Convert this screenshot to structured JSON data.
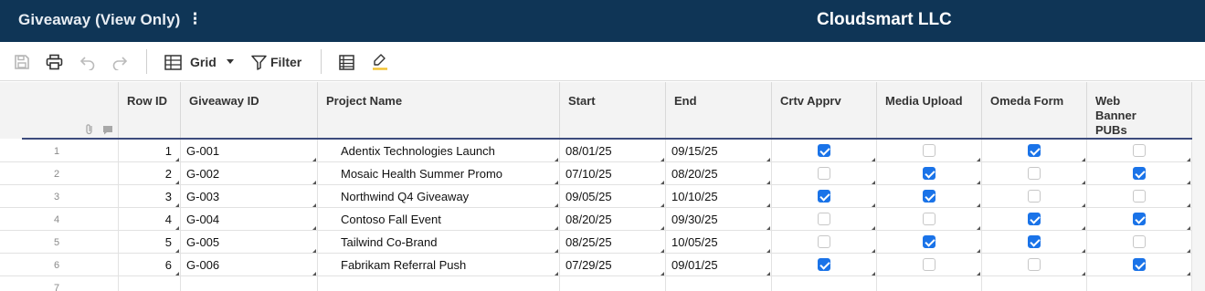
{
  "header": {
    "sheet_title": "Giveaway (View Only)",
    "title_menu_icon": "⋮",
    "company": "Cloudsmart LLC"
  },
  "toolbar": {
    "grid_label": "Grid",
    "filter_label": "Filter"
  },
  "columns": [
    {
      "key": "row_id",
      "label": "Row ID"
    },
    {
      "key": "giveaway_id",
      "label": "Giveaway ID"
    },
    {
      "key": "project_name",
      "label": "Project Name"
    },
    {
      "key": "start",
      "label": "Start"
    },
    {
      "key": "end",
      "label": "End"
    },
    {
      "key": "crtv_apprv",
      "label": "Crtv Apprv"
    },
    {
      "key": "media_upload",
      "label": "Media Upload"
    },
    {
      "key": "omeda_form",
      "label": "Omeda Form"
    },
    {
      "key": "web_banner_pubs",
      "label": "Web Banner PUBs"
    }
  ],
  "rows": [
    {
      "num": "1",
      "row_id": "1",
      "giveaway_id": "G-001",
      "project_name": "Adentix Technologies Launch",
      "start": "08/01/25",
      "end": "09/15/25",
      "crtv_apprv": true,
      "media_upload": false,
      "omeda_form": true,
      "web_banner_pubs": false
    },
    {
      "num": "2",
      "row_id": "2",
      "giveaway_id": "G-002",
      "project_name": "Mosaic Health Summer Promo",
      "start": "07/10/25",
      "end": "08/20/25",
      "crtv_apprv": false,
      "media_upload": true,
      "omeda_form": false,
      "web_banner_pubs": true
    },
    {
      "num": "3",
      "row_id": "3",
      "giveaway_id": "G-003",
      "project_name": "Northwind Q4 Giveaway",
      "start": "09/05/25",
      "end": "10/10/25",
      "crtv_apprv": true,
      "media_upload": true,
      "omeda_form": false,
      "web_banner_pubs": false
    },
    {
      "num": "4",
      "row_id": "4",
      "giveaway_id": "G-004",
      "project_name": "Contoso Fall Event",
      "start": "08/20/25",
      "end": "09/30/25",
      "crtv_apprv": false,
      "media_upload": false,
      "omeda_form": true,
      "web_banner_pubs": true
    },
    {
      "num": "5",
      "row_id": "5",
      "giveaway_id": "G-005",
      "project_name": "Tailwind Co-Brand",
      "start": "08/25/25",
      "end": "10/05/25",
      "crtv_apprv": false,
      "media_upload": true,
      "omeda_form": true,
      "web_banner_pubs": false
    },
    {
      "num": "6",
      "row_id": "6",
      "giveaway_id": "G-006",
      "project_name": "Fabrikam Referral Push",
      "start": "07/29/25",
      "end": "09/01/25",
      "crtv_apprv": true,
      "media_upload": false,
      "omeda_form": false,
      "web_banner_pubs": true
    },
    {
      "num": "7",
      "row_id": "",
      "giveaway_id": "",
      "project_name": "",
      "start": "",
      "end": "",
      "crtv_apprv": null,
      "media_upload": null,
      "omeda_form": null,
      "web_banner_pubs": null
    }
  ],
  "colors": {
    "header_bg": "#0f3556",
    "checkbox_checked": "#1a73e8",
    "header_divider": "#3c4b7c"
  }
}
